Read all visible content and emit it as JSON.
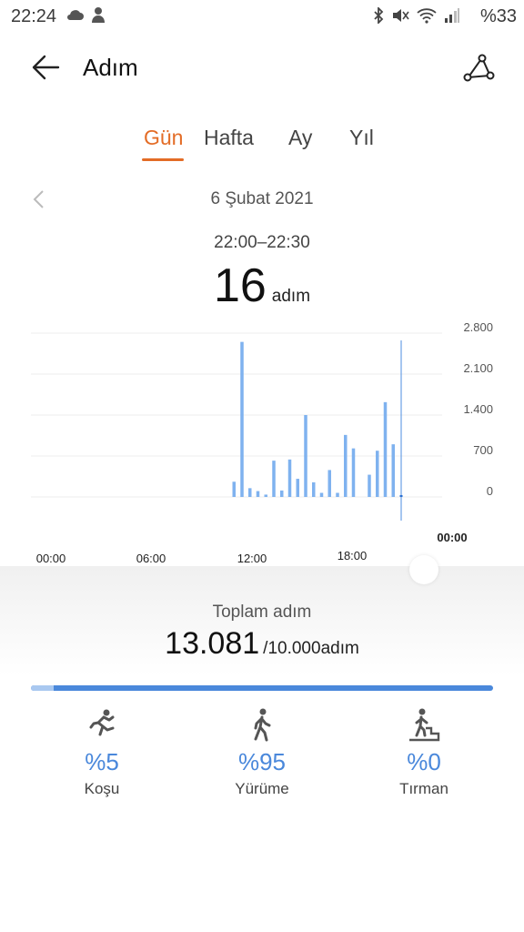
{
  "status_bar": {
    "time": "22:24",
    "battery": "%33",
    "icons": [
      "cloud-icon",
      "person-icon",
      "bluetooth-icon",
      "mute-icon",
      "wifi-icon",
      "signal-icon"
    ]
  },
  "header": {
    "title": "Adım"
  },
  "tabs": [
    {
      "label": "Gün",
      "active": true
    },
    {
      "label": "Hafta",
      "active": false
    },
    {
      "label": "Ay",
      "active": false
    },
    {
      "label": "Yıl",
      "active": false
    }
  ],
  "date": "6 Şubat 2021",
  "selection": {
    "range": "22:00–22:30",
    "value": "16",
    "unit": "adım"
  },
  "chart_data": {
    "type": "bar",
    "y_ticks": [
      "2.800",
      "2.100",
      "1.400",
      "700",
      "0"
    ],
    "ylim": [
      0,
      2800
    ],
    "x_ticks": [
      "00:00",
      "06:00",
      "12:00",
      "18:00",
      "00:00"
    ],
    "bar_color": "#7fb2ef",
    "selected_color": "#2a6fd1",
    "bars": [
      {
        "x": 11.5,
        "y": 260
      },
      {
        "x": 12.0,
        "y": 2650
      },
      {
        "x": 12.5,
        "y": 150
      },
      {
        "x": 13.0,
        "y": 100
      },
      {
        "x": 13.5,
        "y": 40
      },
      {
        "x": 14.0,
        "y": 620
      },
      {
        "x": 14.5,
        "y": 110
      },
      {
        "x": 15.0,
        "y": 640
      },
      {
        "x": 15.5,
        "y": 310
      },
      {
        "x": 16.0,
        "y": 1400
      },
      {
        "x": 16.5,
        "y": 250
      },
      {
        "x": 17.0,
        "y": 70
      },
      {
        "x": 17.5,
        "y": 460
      },
      {
        "x": 18.0,
        "y": 70
      },
      {
        "x": 18.5,
        "y": 1060
      },
      {
        "x": 19.0,
        "y": 830
      },
      {
        "x": 20.0,
        "y": 380
      },
      {
        "x": 20.5,
        "y": 790
      },
      {
        "x": 21.0,
        "y": 1620
      },
      {
        "x": 21.5,
        "y": 900
      },
      {
        "x": 22.0,
        "y": 16,
        "selected": true
      }
    ]
  },
  "summary": {
    "total_label": "Toplam adım",
    "total_value": "13.081",
    "goal": "/10.000adım",
    "run_share": 0.05
  },
  "breakdown": [
    {
      "pct": "%5",
      "label": "Koşu",
      "icon": "running-icon"
    },
    {
      "pct": "%95",
      "label": "Yürüme",
      "icon": "walking-icon"
    },
    {
      "pct": "%0",
      "label": "Tırman",
      "icon": "climbing-icon"
    }
  ]
}
